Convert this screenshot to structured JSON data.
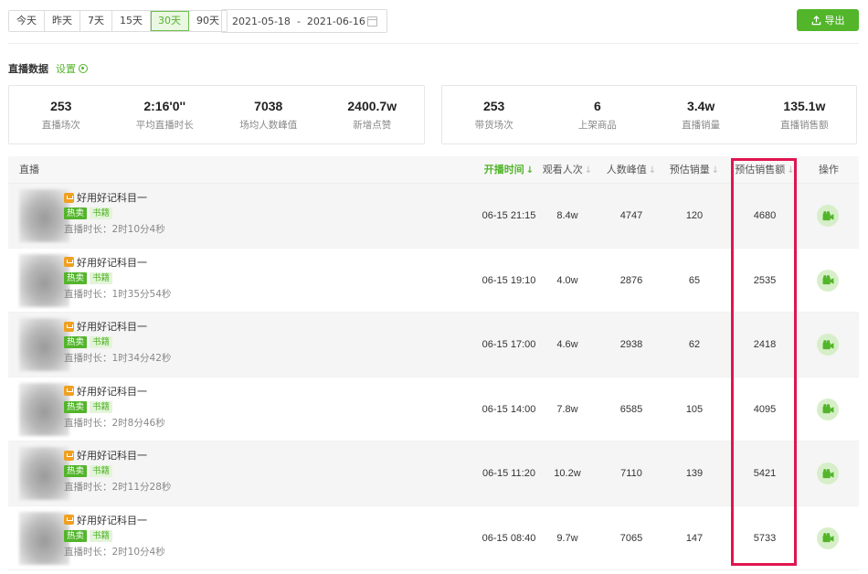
{
  "toolbar": {
    "ranges": [
      "今天",
      "昨天",
      "7天",
      "15天",
      "30天",
      "90天"
    ],
    "active_range": "30天",
    "date_start": "2021-05-18",
    "date_sep": "-",
    "date_end": "2021-06-16",
    "export_label": "导出"
  },
  "section": {
    "title": "直播数据",
    "settings_label": "设置"
  },
  "stats_left": [
    {
      "value": "253",
      "label": "直播场次"
    },
    {
      "value": "2:16'0''",
      "label": "平均直播时长"
    },
    {
      "value": "7038",
      "label": "场均人数峰值"
    },
    {
      "value": "2400.7w",
      "label": "新增点赞"
    }
  ],
  "stats_right": [
    {
      "value": "253",
      "label": "带货场次"
    },
    {
      "value": "6",
      "label": "上架商品"
    },
    {
      "value": "3.4w",
      "label": "直播销量"
    },
    {
      "value": "135.1w",
      "label": "直播销售额"
    }
  ],
  "table": {
    "headers": {
      "live": "直播",
      "start_time": "开播时间",
      "views": "观看人次",
      "peak": "人数峰值",
      "sales": "预估销量",
      "revenue": "预估销售额",
      "action": "操作"
    },
    "rows": [
      {
        "title": "好用好记科目一",
        "tag_hot": "热卖",
        "tag_cat": "书籍",
        "duration": "直播时长：2时10分4秒",
        "start": "06-15 21:15",
        "views": "8.4w",
        "peak": "4747",
        "sales": "120",
        "revenue": "4680"
      },
      {
        "title": "好用好记科目一",
        "tag_hot": "热卖",
        "tag_cat": "书籍",
        "duration": "直播时长：1时35分54秒",
        "start": "06-15 19:10",
        "views": "4.0w",
        "peak": "2876",
        "sales": "65",
        "revenue": "2535"
      },
      {
        "title": "好用好记科目一",
        "tag_hot": "热卖",
        "tag_cat": "书籍",
        "duration": "直播时长：1时34分42秒",
        "start": "06-15 17:00",
        "views": "4.6w",
        "peak": "2938",
        "sales": "62",
        "revenue": "2418"
      },
      {
        "title": "好用好记科目一",
        "tag_hot": "热卖",
        "tag_cat": "书籍",
        "duration": "直播时长：2时8分46秒",
        "start": "06-15 14:00",
        "views": "7.8w",
        "peak": "6585",
        "sales": "105",
        "revenue": "4095"
      },
      {
        "title": "好用好记科目一",
        "tag_hot": "热卖",
        "tag_cat": "书籍",
        "duration": "直播时长：2时11分28秒",
        "start": "06-15 11:20",
        "views": "10.2w",
        "peak": "7110",
        "sales": "139",
        "revenue": "5421"
      },
      {
        "title": "好用好记科目一",
        "tag_hot": "热卖",
        "tag_cat": "书籍",
        "duration": "直播时长：2时10分4秒",
        "start": "06-15 08:40",
        "views": "9.7w",
        "peak": "7065",
        "sales": "147",
        "revenue": "5733"
      }
    ]
  },
  "colors": {
    "accent": "#52b52a",
    "highlight": "#e0154f"
  }
}
